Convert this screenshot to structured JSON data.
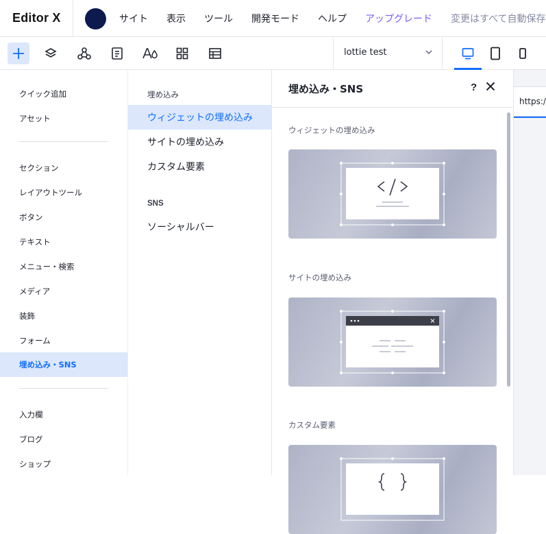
{
  "app": {
    "logo": "Editor X"
  },
  "menu": {
    "site": "サイト",
    "view": "表示",
    "tools": "ツール",
    "dev_mode": "開発モード",
    "help": "ヘルプ",
    "upgrade": "アップグレード",
    "status": "変更はすべて自動保存"
  },
  "toolbar": {
    "page_name": "lottie test"
  },
  "leftnav": {
    "items": [
      "クイック追加",
      "アセット",
      "セクション",
      "レイアウトツール",
      "ボタン",
      "テキスト",
      "メニュー・検索",
      "メディア",
      "装飾",
      "フォーム",
      "埋め込み・SNS",
      "入力欄",
      "ブログ",
      "ショップ"
    ]
  },
  "subnav": {
    "heading_embed": "埋め込み",
    "embed_items": [
      "ウィジェットの埋め込み",
      "サイトの埋め込み",
      "カスタム要素"
    ],
    "heading_sns": "SNS",
    "sns_items": [
      "ソーシャルバー"
    ]
  },
  "panel": {
    "title": "埋め込み・SNS",
    "help": "?",
    "sections": [
      "ウィジェットの埋め込み",
      "サイトの埋め込み",
      "カスタム要素"
    ]
  },
  "canvas": {
    "url": "https://"
  },
  "colors": {
    "accent": "#116dff",
    "active_bg": "#dce7fc",
    "upgrade": "#7a5cf5",
    "avatar": "#0c1a4d"
  }
}
